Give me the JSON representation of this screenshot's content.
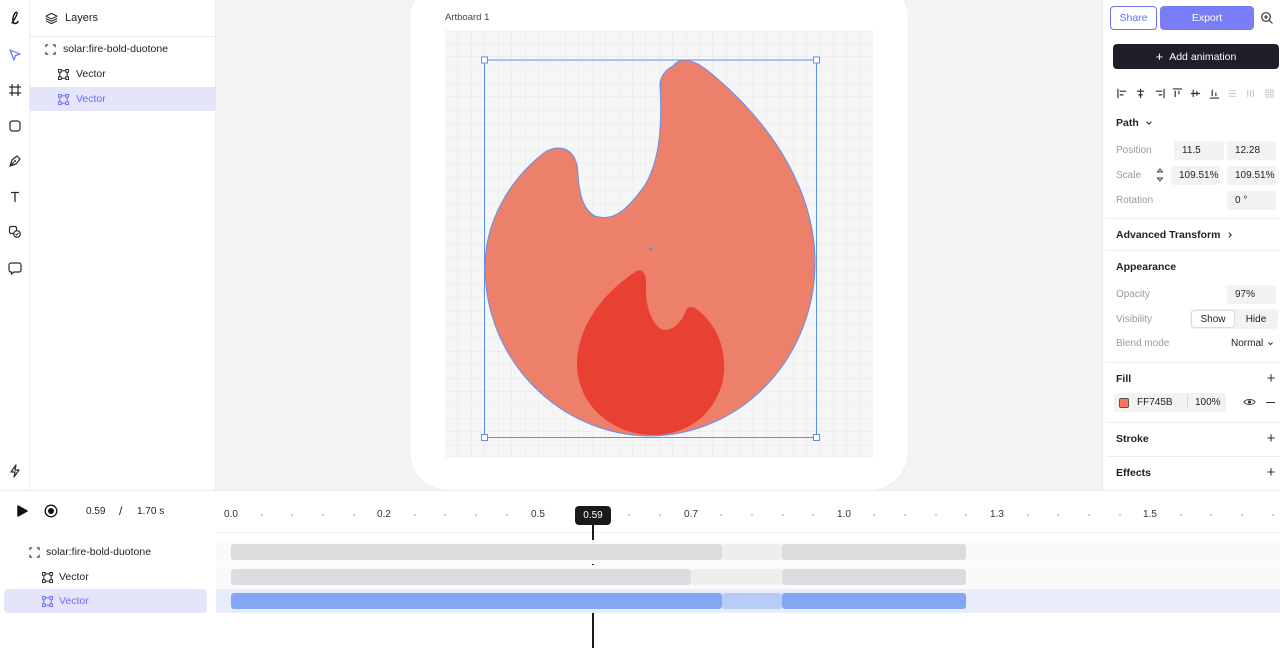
{
  "layers_panel": {
    "title": "Layers",
    "items": [
      {
        "label": "solar:fire-bold-duotone",
        "type": "group"
      },
      {
        "label": "Vector",
        "type": "vector"
      },
      {
        "label": "Vector",
        "type": "vector",
        "selected": true
      }
    ]
  },
  "canvas": {
    "artboard_label": "Artboard 1",
    "fill_back": "#ED7D66",
    "fill_front": "#E84133",
    "selection_color": "#5b8ff0"
  },
  "header": {
    "share_label": "Share",
    "export_label": "Export",
    "add_animation_label": "Add animation"
  },
  "properties": {
    "path_title": "Path",
    "position_label": "Position",
    "position_x": "11.5",
    "position_y": "12.28",
    "scale_label": "Scale",
    "scale_x": "109.51%",
    "scale_y": "109.51%",
    "rotation_label": "Rotation",
    "rotation_value": "0 °",
    "advanced_transform_title": "Advanced Transform",
    "appearance_title": "Appearance",
    "opacity_label": "Opacity",
    "opacity_value": "97%",
    "visibility_label": "Visibility",
    "visibility_show": "Show",
    "visibility_hide": "Hide",
    "blend_label": "Blend mode",
    "blend_value": "Normal",
    "fill_title": "Fill",
    "fill_hex": "FF745B",
    "fill_opacity": "100%",
    "fill_color": "#FF745B",
    "stroke_title": "Stroke",
    "effects_title": "Effects"
  },
  "timeline": {
    "current_time": "0.59",
    "separator": "/",
    "duration": "1.70 s",
    "playhead_label": "0.59",
    "ticks": [
      "0.0",
      "0.2",
      "0.5",
      "0.7",
      "1.0",
      "1.3",
      "1.5"
    ],
    "layers": [
      {
        "label": "solar:fire-bold-duotone"
      },
      {
        "label": "Vector"
      },
      {
        "label": "Vector",
        "selected": true
      }
    ]
  }
}
